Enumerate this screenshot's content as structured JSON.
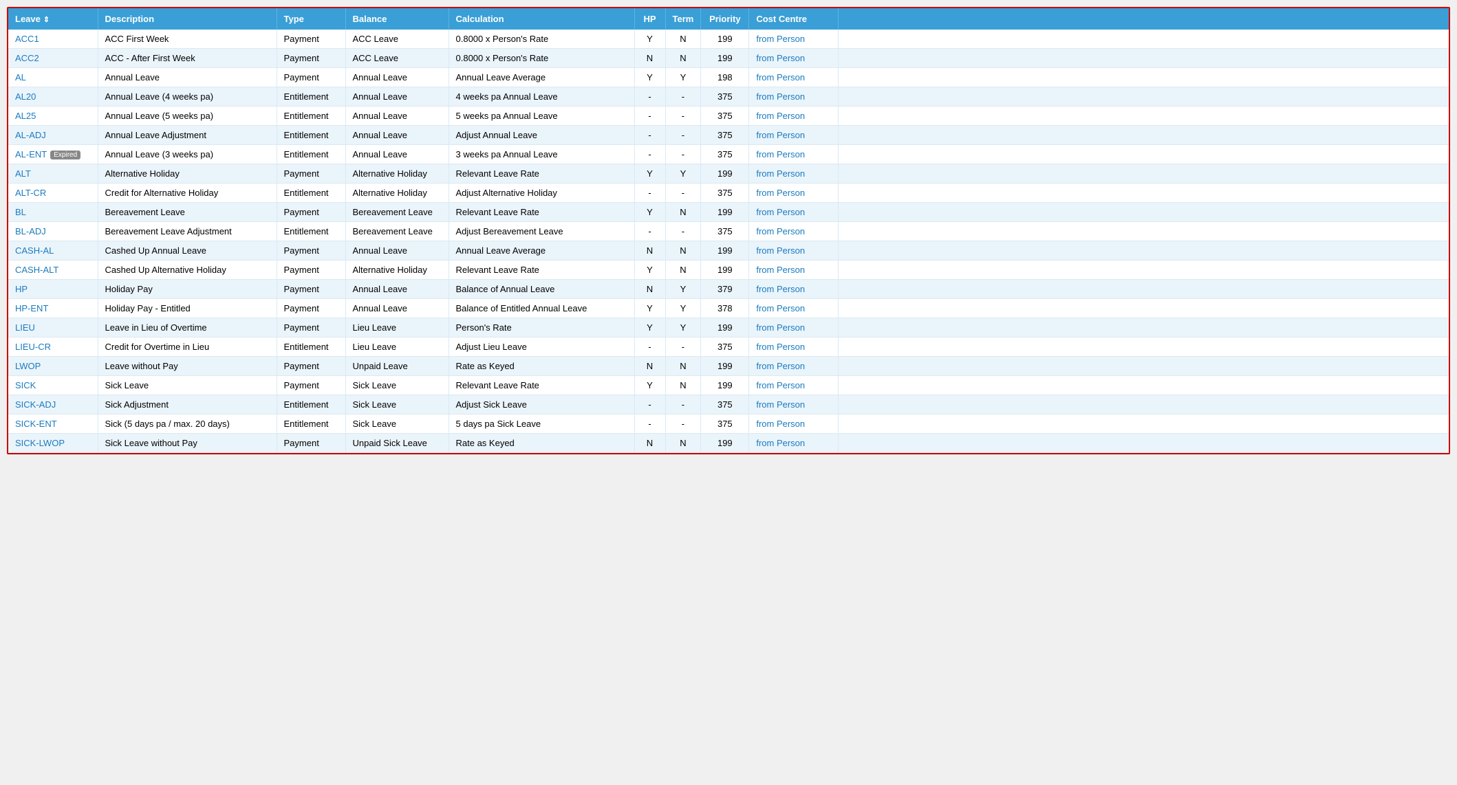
{
  "table": {
    "columns": [
      {
        "key": "leave",
        "label": "Leave",
        "sortable": true,
        "class": "col-leave"
      },
      {
        "key": "description",
        "label": "Description",
        "sortable": false,
        "class": "col-desc"
      },
      {
        "key": "type",
        "label": "Type",
        "sortable": false,
        "class": "col-type"
      },
      {
        "key": "balance",
        "label": "Balance",
        "sortable": false,
        "class": "col-balance"
      },
      {
        "key": "calculation",
        "label": "Calculation",
        "sortable": false,
        "class": "col-calc"
      },
      {
        "key": "hp",
        "label": "HP",
        "sortable": false,
        "class": "col-hp"
      },
      {
        "key": "term",
        "label": "Term",
        "sortable": false,
        "class": "col-term"
      },
      {
        "key": "priority",
        "label": "Priority",
        "sortable": false,
        "class": "col-priority"
      },
      {
        "key": "costCentre",
        "label": "Cost Centre",
        "sortable": false,
        "class": "col-cost"
      },
      {
        "key": "extra",
        "label": "",
        "sortable": false,
        "class": "col-extra"
      }
    ],
    "rows": [
      {
        "leave": "ACC1",
        "expired": false,
        "description": "ACC First Week",
        "type": "Payment",
        "balance": "ACC Leave",
        "calculation": "0.8000 x Person's Rate",
        "hp": "Y",
        "term": "N",
        "priority": "199",
        "costCentre": "from Person"
      },
      {
        "leave": "ACC2",
        "expired": false,
        "description": "ACC - After First Week",
        "type": "Payment",
        "balance": "ACC Leave",
        "calculation": "0.8000 x Person's Rate",
        "hp": "N",
        "term": "N",
        "priority": "199",
        "costCentre": "from Person"
      },
      {
        "leave": "AL",
        "expired": false,
        "description": "Annual Leave",
        "type": "Payment",
        "balance": "Annual Leave",
        "calculation": "Annual Leave Average",
        "hp": "Y",
        "term": "Y",
        "priority": "198",
        "costCentre": "from Person"
      },
      {
        "leave": "AL20",
        "expired": false,
        "description": "Annual Leave (4 weeks pa)",
        "type": "Entitlement",
        "balance": "Annual Leave",
        "calculation": "4 weeks pa Annual Leave",
        "hp": "-",
        "term": "-",
        "priority": "375",
        "costCentre": "from Person"
      },
      {
        "leave": "AL25",
        "expired": false,
        "description": "Annual Leave (5 weeks pa)",
        "type": "Entitlement",
        "balance": "Annual Leave",
        "calculation": "5 weeks pa Annual Leave",
        "hp": "-",
        "term": "-",
        "priority": "375",
        "costCentre": "from Person"
      },
      {
        "leave": "AL-ADJ",
        "expired": false,
        "description": "Annual Leave Adjustment",
        "type": "Entitlement",
        "balance": "Annual Leave",
        "calculation": "Adjust Annual Leave",
        "hp": "-",
        "term": "-",
        "priority": "375",
        "costCentre": "from Person"
      },
      {
        "leave": "AL-ENT",
        "expired": true,
        "description": "Annual Leave (3 weeks pa)",
        "type": "Entitlement",
        "balance": "Annual Leave",
        "calculation": "3 weeks pa Annual Leave",
        "hp": "-",
        "term": "-",
        "priority": "375",
        "costCentre": "from Person"
      },
      {
        "leave": "ALT",
        "expired": false,
        "description": "Alternative Holiday",
        "type": "Payment",
        "balance": "Alternative Holiday",
        "calculation": "Relevant Leave Rate",
        "hp": "Y",
        "term": "Y",
        "priority": "199",
        "costCentre": "from Person"
      },
      {
        "leave": "ALT-CR",
        "expired": false,
        "description": "Credit for Alternative Holiday",
        "type": "Entitlement",
        "balance": "Alternative Holiday",
        "calculation": "Adjust Alternative Holiday",
        "hp": "-",
        "term": "-",
        "priority": "375",
        "costCentre": "from Person"
      },
      {
        "leave": "BL",
        "expired": false,
        "description": "Bereavement Leave",
        "type": "Payment",
        "balance": "Bereavement Leave",
        "calculation": "Relevant Leave Rate",
        "hp": "Y",
        "term": "N",
        "priority": "199",
        "costCentre": "from Person"
      },
      {
        "leave": "BL-ADJ",
        "expired": false,
        "description": "Bereavement Leave Adjustment",
        "type": "Entitlement",
        "balance": "Bereavement Leave",
        "calculation": "Adjust Bereavement Leave",
        "hp": "-",
        "term": "-",
        "priority": "375",
        "costCentre": "from Person"
      },
      {
        "leave": "CASH-AL",
        "expired": false,
        "description": "Cashed Up Annual Leave",
        "type": "Payment",
        "balance": "Annual Leave",
        "calculation": "Annual Leave Average",
        "hp": "N",
        "term": "N",
        "priority": "199",
        "costCentre": "from Person"
      },
      {
        "leave": "CASH-ALT",
        "expired": false,
        "description": "Cashed Up Alternative Holiday",
        "type": "Payment",
        "balance": "Alternative Holiday",
        "calculation": "Relevant Leave Rate",
        "hp": "Y",
        "term": "N",
        "priority": "199",
        "costCentre": "from Person"
      },
      {
        "leave": "HP",
        "expired": false,
        "description": "Holiday Pay",
        "type": "Payment",
        "balance": "Annual Leave",
        "calculation": "Balance of Annual Leave",
        "hp": "N",
        "term": "Y",
        "priority": "379",
        "costCentre": "from Person"
      },
      {
        "leave": "HP-ENT",
        "expired": false,
        "description": "Holiday Pay - Entitled",
        "type": "Payment",
        "balance": "Annual Leave",
        "calculation": "Balance of Entitled Annual Leave",
        "hp": "Y",
        "term": "Y",
        "priority": "378",
        "costCentre": "from Person"
      },
      {
        "leave": "LIEU",
        "expired": false,
        "description": "Leave in Lieu of Overtime",
        "type": "Payment",
        "balance": "Lieu Leave",
        "calculation": "Person's Rate",
        "hp": "Y",
        "term": "Y",
        "priority": "199",
        "costCentre": "from Person"
      },
      {
        "leave": "LIEU-CR",
        "expired": false,
        "description": "Credit for Overtime in Lieu",
        "type": "Entitlement",
        "balance": "Lieu Leave",
        "calculation": "Adjust Lieu Leave",
        "hp": "-",
        "term": "-",
        "priority": "375",
        "costCentre": "from Person"
      },
      {
        "leave": "LWOP",
        "expired": false,
        "description": "Leave without Pay",
        "type": "Payment",
        "balance": "Unpaid Leave",
        "calculation": "Rate as Keyed",
        "hp": "N",
        "term": "N",
        "priority": "199",
        "costCentre": "from Person"
      },
      {
        "leave": "SICK",
        "expired": false,
        "description": "Sick Leave",
        "type": "Payment",
        "balance": "Sick Leave",
        "calculation": "Relevant Leave Rate",
        "hp": "Y",
        "term": "N",
        "priority": "199",
        "costCentre": "from Person"
      },
      {
        "leave": "SICK-ADJ",
        "expired": false,
        "description": "Sick Adjustment",
        "type": "Entitlement",
        "balance": "Sick Leave",
        "calculation": "Adjust Sick Leave",
        "hp": "-",
        "term": "-",
        "priority": "375",
        "costCentre": "from Person"
      },
      {
        "leave": "SICK-ENT",
        "expired": false,
        "description": "Sick (5 days pa / max. 20 days)",
        "type": "Entitlement",
        "balance": "Sick Leave",
        "calculation": "5 days pa Sick Leave",
        "hp": "-",
        "term": "-",
        "priority": "375",
        "costCentre": "from Person"
      },
      {
        "leave": "SICK-LWOP",
        "expired": false,
        "description": "Sick Leave without Pay",
        "type": "Payment",
        "balance": "Unpaid Sick Leave",
        "calculation": "Rate as Keyed",
        "hp": "N",
        "term": "N",
        "priority": "199",
        "costCentre": "from Person"
      }
    ],
    "expiredBadgeLabel": "Expired"
  }
}
